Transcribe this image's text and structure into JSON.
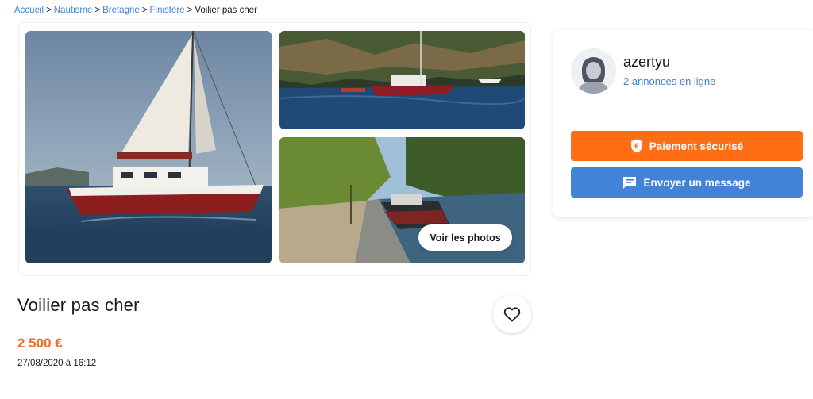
{
  "breadcrumb": {
    "items": [
      "Accueil",
      "Nautisme",
      "Bretagne",
      "Finistère"
    ],
    "separator": ">",
    "current": "Voilier pas cher"
  },
  "gallery": {
    "see_photos_label": "Voir les photos"
  },
  "listing": {
    "title": "Voilier pas cher",
    "price": "2 500 €",
    "date": "27/08/2020 à 16:12"
  },
  "seller": {
    "name": "azertyu",
    "ads_count_label": "2 annonces en ligne"
  },
  "actions": {
    "secure_payment_label": "Paiement sécurisé",
    "send_message_label": "Envoyer un message"
  },
  "colors": {
    "link": "#4183d7",
    "price": "#f56b2a",
    "payment_button": "#ff6e14",
    "message_button": "#4183d7"
  },
  "icons": {
    "favorite": "heart-icon",
    "payment": "shield-euro-icon",
    "message": "chat-bubble-icon",
    "avatar": "user-avatar-icon"
  }
}
